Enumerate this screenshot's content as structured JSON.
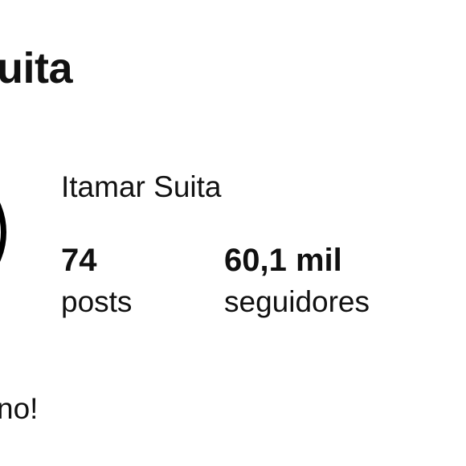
{
  "header": {
    "username": "uita"
  },
  "profile": {
    "full_name": "Itamar Suita",
    "bio": "no!"
  },
  "stats": {
    "posts": {
      "value": "74",
      "label": "posts"
    },
    "followers": {
      "value": "60,1 mil",
      "label": "seguidores"
    }
  }
}
